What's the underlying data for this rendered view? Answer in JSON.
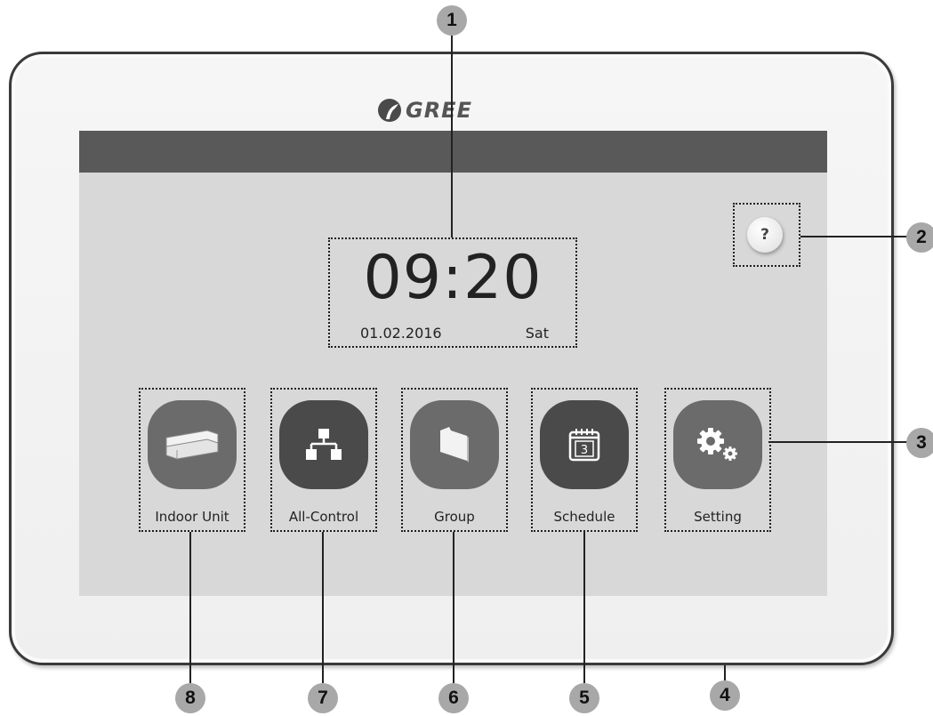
{
  "brand": {
    "name": "GREE"
  },
  "clock": {
    "time": "09:20",
    "date": "01.02.2016",
    "day": "Sat"
  },
  "help": {
    "label": "?"
  },
  "tiles": [
    {
      "label": "Indoor Unit",
      "icon": "indoor-unit-icon"
    },
    {
      "label": "All-Control",
      "icon": "network-icon"
    },
    {
      "label": "Group",
      "icon": "folder-icon"
    },
    {
      "label": "Schedule",
      "icon": "calendar-icon",
      "calendar_day": "3"
    },
    {
      "label": "Setting",
      "icon": "gears-icon"
    }
  ],
  "callouts": [
    "1",
    "2",
    "3",
    "4",
    "5",
    "6",
    "7",
    "8"
  ]
}
